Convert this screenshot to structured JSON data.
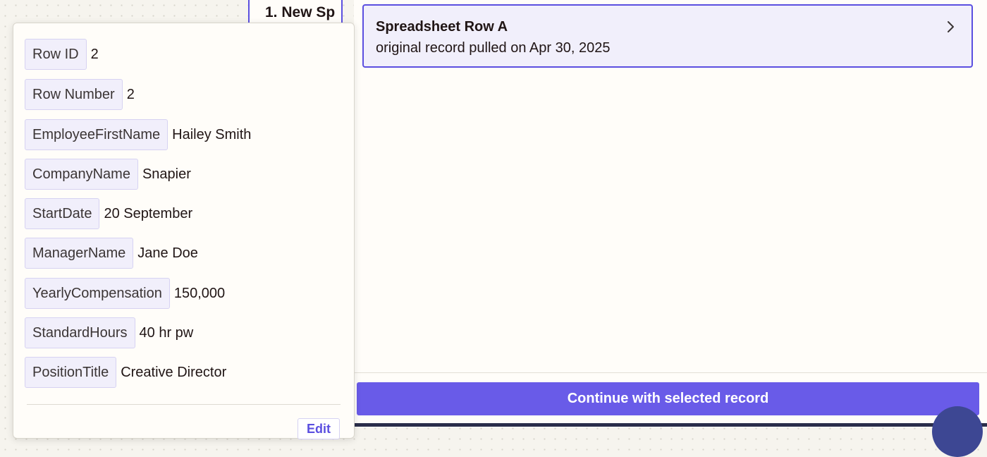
{
  "step_header": {
    "label": "1. New Sp"
  },
  "record": {
    "title": "Spreadsheet Row A",
    "subtitle": "original record pulled on Apr 30, 2025",
    "chevron_icon": "chevron-right-icon"
  },
  "fields": [
    {
      "key": "Row ID",
      "value": "2"
    },
    {
      "key": "Row Number",
      "value": "2"
    },
    {
      "key": "EmployeeFirstName",
      "value": "Hailey Smith"
    },
    {
      "key": "CompanyName",
      "value": "Snapier"
    },
    {
      "key": "StartDate",
      "value": "20 September"
    },
    {
      "key": "ManagerName",
      "value": "Jane Doe"
    },
    {
      "key": "YearlyCompensation",
      "value": "150,000"
    },
    {
      "key": "StandardHours",
      "value": "40 hr pw"
    },
    {
      "key": "PositionTitle",
      "value": "Creative Director"
    }
  ],
  "popover": {
    "edit_label": "Edit"
  },
  "footer": {
    "continue_label": "Continue with selected record"
  },
  "colors": {
    "accent": "#695be8",
    "accent_border": "#5b4fe0",
    "card_bg": "#f1effb",
    "background": "#f6f4ee"
  }
}
